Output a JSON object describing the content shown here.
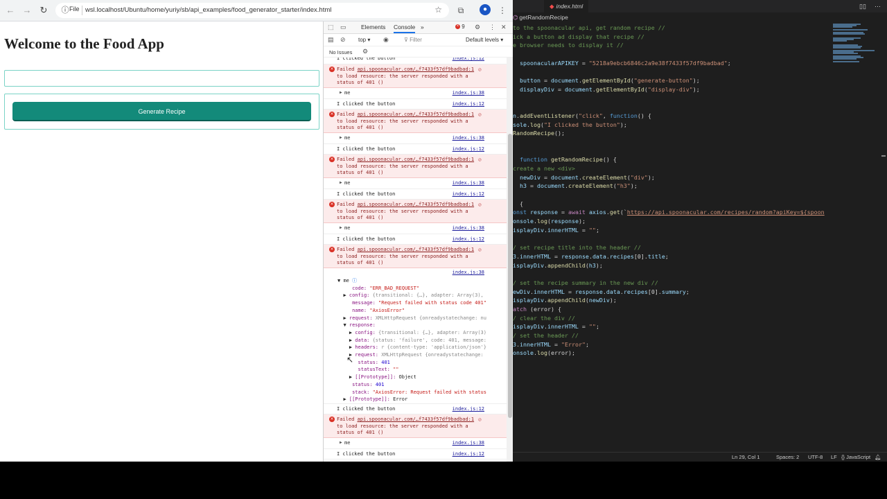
{
  "browser": {
    "nav": {
      "back": "←",
      "forward": "→",
      "reload": "↻"
    },
    "file_chip": "File",
    "url": "wsl.localhost/Ubuntu/home/yuriy/sb/api_examples/food_generator_starter/index.html"
  },
  "page": {
    "title": "Welcome to the Food App",
    "input_value": "",
    "generate_label": "Generate Recipe"
  },
  "devtools": {
    "tab_elements": "Elements",
    "tab_console": "Console",
    "more_tabs": "»",
    "error_count": "9",
    "context": "top ▾",
    "filter_placeholder": "Filter",
    "levels": "Default levels ▾",
    "issues": "No Issues",
    "log_click_text": "I clicked the button",
    "src_click": "index.js:12",
    "src_log": "index.js:38",
    "err_prefix": "Failed ",
    "err_link": "api.spoonacular.com/…f7433f57df9badbad:1",
    "err_line2": "to load resource: the server responded with a",
    "err_line3": "status of 401 ()",
    "me_label": "me",
    "tree": {
      "code_key": "code:",
      "code_val": "\"ERR_BAD_REQUEST\"",
      "config_key": "config:",
      "config_val": "{transitional: {…}, adapter: Array(3),",
      "message_key": "message:",
      "message_val": "\"Request failed with status code 401\"",
      "name_key": "name:",
      "name_val": "\"AxiosError\"",
      "request_key": "request:",
      "request_val": "XMLHttpRequest {onreadystatechange: nu",
      "response_key": "response:",
      "r_config_key": "config:",
      "r_config_val": "{transitional: {…}, adapter: Array(3)",
      "r_data_key": "data:",
      "r_data_val": "{status: 'failure', code: 401, message:",
      "r_headers_key": "headers:",
      "r_headers_val": "r {content-type: 'application/json'}",
      "r_request_key": "request:",
      "r_request_val": "XMLHttpRequest {onreadystatechange:",
      "r_status_key": "status:",
      "r_status_val": "401",
      "r_statustext_key": "statusText:",
      "r_statustext_val": "\"\"",
      "r_proto_key": "[[Prototype]]:",
      "r_proto_val": "Object",
      "status_key": "status:",
      "status_val": "401",
      "stack_key": "stack:",
      "stack_val": "\"AxiosError: Request failed with status",
      "proto_key": "[[Prototype]]:",
      "proto_val": "Error"
    }
  },
  "editor": {
    "tab_label": "index.html",
    "tab_icon": "JS",
    "breadcrumb": "getRandomRecipe",
    "code_lines": [
      [
        [
          "c-cm",
          "to the spoonacular api, get random recipe //"
        ]
      ],
      [
        [
          "c-cm",
          "ick a button ad display that recipe //"
        ]
      ],
      [
        [
          "c-cm",
          "e browser needs to display it //"
        ]
      ],
      [],
      [
        [
          "c-var",
          "  spoonacularAPIKEY"
        ],
        [
          "",
          " = "
        ],
        [
          "c-str",
          "\"5218a9ebcb6846c2a9e38f7433f57df9badbad\""
        ],
        [
          "",
          ";"
        ]
      ],
      [],
      [
        [
          "c-var",
          "  button"
        ],
        [
          "",
          " = "
        ],
        [
          "c-var",
          "document"
        ],
        [
          "",
          "."
        ],
        [
          "c-fn",
          "getElementById"
        ],
        [
          "",
          "("
        ],
        [
          "c-str",
          "\"generate-button\""
        ],
        [
          "",
          ");"
        ]
      ],
      [
        [
          "c-var",
          "  displayDiv"
        ],
        [
          "",
          " = "
        ],
        [
          "c-var",
          "document"
        ],
        [
          "",
          "."
        ],
        [
          "c-fn",
          "getElementById"
        ],
        [
          "",
          "("
        ],
        [
          "c-str",
          "\"display-div\""
        ],
        [
          "",
          ");"
        ]
      ],
      [],
      [],
      [
        [
          "c-var",
          "n"
        ],
        [
          "",
          "."
        ],
        [
          "c-fn",
          "addEventListener"
        ],
        [
          "",
          "("
        ],
        [
          "c-str",
          "\"click\""
        ],
        [
          "",
          ", "
        ],
        [
          "c-kw",
          "function"
        ],
        [
          "",
          "() {"
        ]
      ],
      [
        [
          "c-var",
          "sole"
        ],
        [
          "",
          "."
        ],
        [
          "c-fn",
          "log"
        ],
        [
          "",
          "("
        ],
        [
          "c-str",
          "\"I clicked the button\""
        ],
        [
          "",
          ");"
        ]
      ],
      [
        [
          "c-fn",
          "RandomRecipe"
        ],
        [
          "",
          "();"
        ]
      ],
      [],
      [],
      [
        [
          "c-kw",
          "  function "
        ],
        [
          "c-fn",
          "getRandomRecipe"
        ],
        [
          "",
          "() {"
        ]
      ],
      [
        [
          "c-cm",
          "create a new <div>"
        ]
      ],
      [
        [
          "c-var",
          "  newDiv"
        ],
        [
          "",
          " = "
        ],
        [
          "c-var",
          "document"
        ],
        [
          "",
          "."
        ],
        [
          "c-fn",
          "createElement"
        ],
        [
          "",
          "("
        ],
        [
          "c-str",
          "\"div\""
        ],
        [
          "",
          ");"
        ]
      ],
      [
        [
          "c-var",
          "  h3"
        ],
        [
          "",
          " = "
        ],
        [
          "c-var",
          "document"
        ],
        [
          "",
          "."
        ],
        [
          "c-fn",
          "createElement"
        ],
        [
          "",
          "("
        ],
        [
          "c-str",
          "\"h3\""
        ],
        [
          "",
          ");"
        ]
      ],
      [],
      [
        [
          "",
          "  {"
        ]
      ],
      [
        [
          "c-kw",
          "onst "
        ],
        [
          "c-var",
          "response"
        ],
        [
          "",
          " = "
        ],
        [
          "c-ctl",
          "await "
        ],
        [
          "c-var",
          "axios"
        ],
        [
          "",
          "."
        ],
        [
          "c-fn",
          "get"
        ],
        [
          "",
          "(`"
        ],
        [
          "c-lnk",
          "https://api.spoonacular.com/recipes/random?apiKey=${spoon"
        ]
      ],
      [
        [
          "c-var",
          "onsole"
        ],
        [
          "",
          "."
        ],
        [
          "c-fn",
          "log"
        ],
        [
          "",
          "("
        ],
        [
          "c-var",
          "response"
        ],
        [
          "",
          ");"
        ]
      ],
      [
        [
          "c-var",
          "isplayDiv"
        ],
        [
          "",
          "."
        ],
        [
          "c-var",
          "innerHTML"
        ],
        [
          "",
          " = "
        ],
        [
          "c-str",
          "\"\""
        ],
        [
          "",
          ";"
        ]
      ],
      [],
      [
        [
          "c-cm",
          "/ set recipe title into the header //"
        ]
      ],
      [
        [
          "c-var",
          "3"
        ],
        [
          "",
          "."
        ],
        [
          "c-var",
          "innerHTML"
        ],
        [
          "",
          " = "
        ],
        [
          "c-var",
          "response"
        ],
        [
          "",
          "."
        ],
        [
          "c-var",
          "data"
        ],
        [
          "",
          "."
        ],
        [
          "c-var",
          "recipes"
        ],
        [
          "",
          "[0]."
        ],
        [
          "c-var",
          "title"
        ],
        [
          "",
          ";"
        ]
      ],
      [
        [
          "c-var",
          "isplayDiv"
        ],
        [
          "",
          "."
        ],
        [
          "c-fn",
          "appendChild"
        ],
        [
          "",
          "("
        ],
        [
          "c-var",
          "h3"
        ],
        [
          "",
          ");"
        ]
      ],
      [],
      [
        [
          "c-cm",
          "/ set the recipe summary in the new div //"
        ]
      ],
      [
        [
          "c-var",
          "ewDiv"
        ],
        [
          "",
          "."
        ],
        [
          "c-var",
          "innerHTML"
        ],
        [
          "",
          " = "
        ],
        [
          "c-var",
          "response"
        ],
        [
          "",
          "."
        ],
        [
          "c-var",
          "data"
        ],
        [
          "",
          "."
        ],
        [
          "c-var",
          "recipes"
        ],
        [
          "",
          "[0]."
        ],
        [
          "c-var",
          "summary"
        ],
        [
          "",
          ";"
        ]
      ],
      [
        [
          "c-var",
          "isplayDiv"
        ],
        [
          "",
          "."
        ],
        [
          "c-fn",
          "appendChild"
        ],
        [
          "",
          "("
        ],
        [
          "c-var",
          "newDiv"
        ],
        [
          "",
          ");"
        ]
      ],
      [
        [
          "c-ctl",
          "atch "
        ],
        [
          "",
          "(error) {"
        ]
      ],
      [
        [
          "c-cm",
          "/ clear the div //"
        ]
      ],
      [
        [
          "c-var",
          "isplayDiv"
        ],
        [
          "",
          "."
        ],
        [
          "c-var",
          "innerHTML"
        ],
        [
          "",
          " = "
        ],
        [
          "c-str",
          "\"\""
        ],
        [
          "",
          ";"
        ]
      ],
      [
        [
          "c-cm",
          "/ set the header //"
        ]
      ],
      [
        [
          "c-var",
          "3"
        ],
        [
          "",
          "."
        ],
        [
          "c-var",
          "innerHTML"
        ],
        [
          "",
          " = "
        ],
        [
          "c-str",
          "\"Error\""
        ],
        [
          "",
          ";"
        ]
      ],
      [
        [
          "c-var",
          "onsole"
        ],
        [
          "",
          "."
        ],
        [
          "c-fn",
          "log"
        ],
        [
          "",
          "(error);"
        ]
      ]
    ],
    "status": {
      "position": "Ln 29, Col 1",
      "spaces": "Spaces: 2",
      "encoding": "UTF-8",
      "eol": "LF",
      "language": "{} JavaScript"
    }
  },
  "colors": {
    "accent_teal": "#138a7a",
    "border_teal": "#7ad3c6",
    "error_red": "#d93025"
  }
}
